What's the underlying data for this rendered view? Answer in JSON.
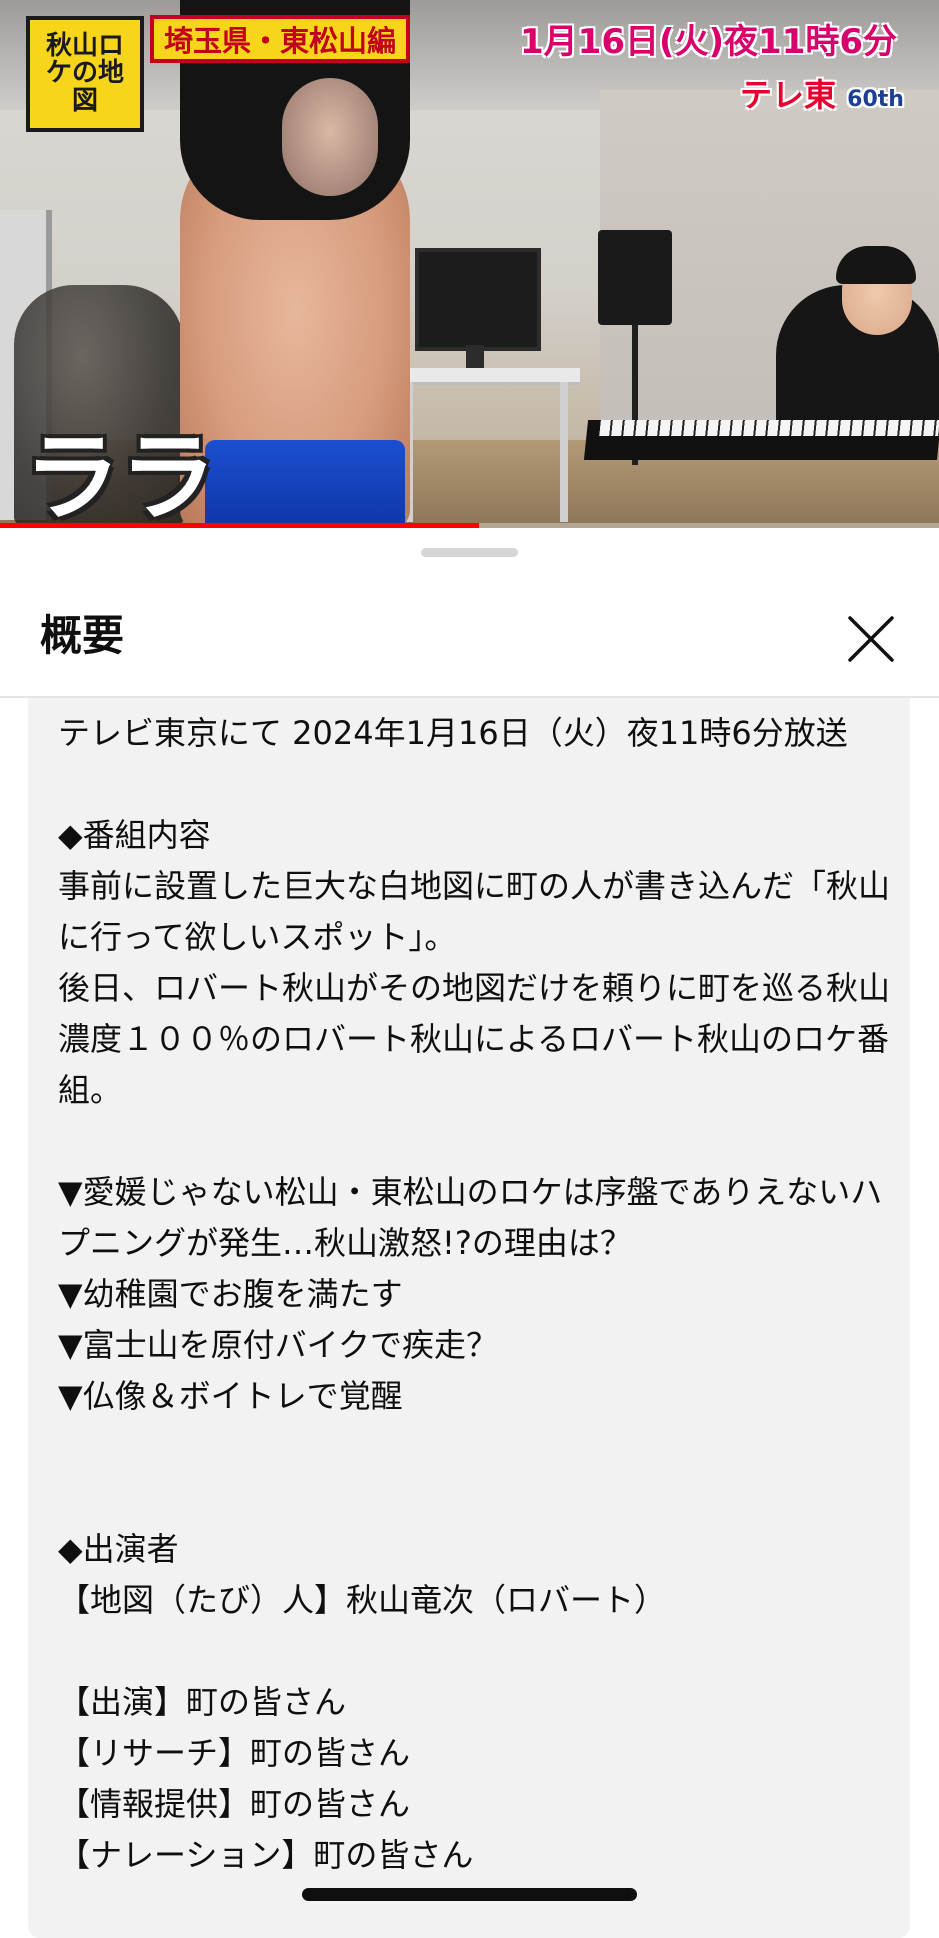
{
  "video": {
    "show_logo_text": "秋山ロケの地図",
    "location_badge": "埼玉県・東松山編",
    "broadcast_time": "1月16日(火)夜11時6分",
    "channel_logo": "テレ東",
    "channel_logo_suffix": "60th",
    "caption": "ララ",
    "progress": 0.51,
    "progress_color": "#ff0000"
  },
  "sheet": {
    "title": "概要",
    "close_icon": "close-icon",
    "description": "テレビ東京にて 2024年1月16日（火）夜11時6分放送\n\n◆番組内容\n事前に設置した巨大な白地図に町の人が書き込んだ「秋山に行って欲しいスポット」。\n後日、ロバート秋山がその地図だけを頼りに町を巡る秋山濃度１００％のロバート秋山によるロバート秋山のロケ番組。\n\n▼愛媛じゃない松山・東松山のロケは序盤でありえないハプニングが発生…秋山激怒!?の理由は？\n▼幼稚園でお腹を満たす\n▼富士山を原付バイクで疾走？\n▼仏像＆ボイトレで覚醒\n\n\n◆出演者\n【地図（たび）人】秋山竜次（ロバート）\n\n【出演】町の皆さん\n【リサーチ】町の皆さん\n【情報提供】町の皆さん\n【ナレーション】町の皆さん"
  }
}
